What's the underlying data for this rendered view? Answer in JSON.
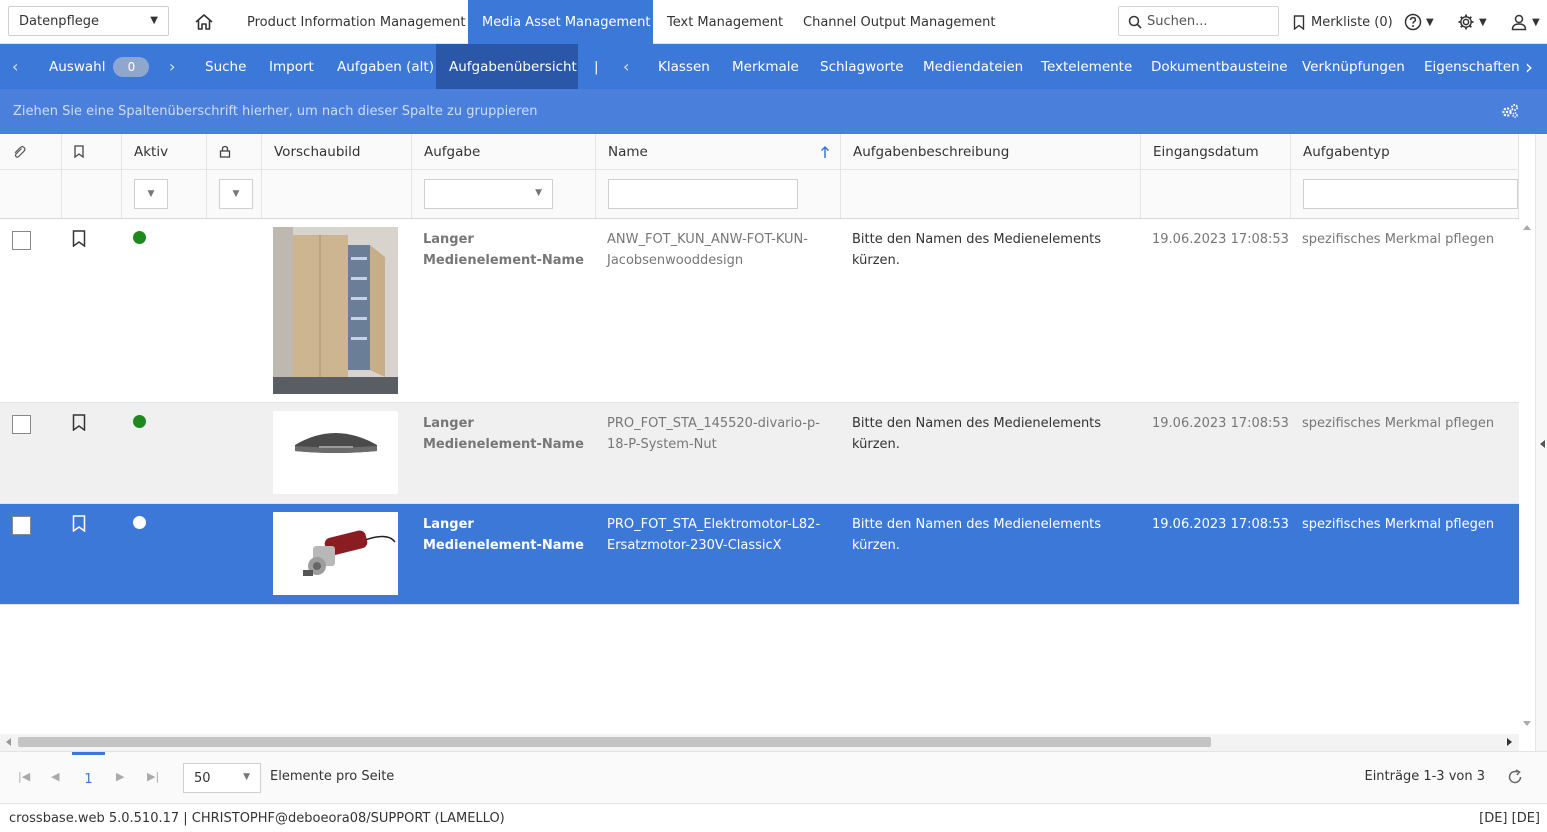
{
  "topbar": {
    "module_select": "Datenpflege",
    "tabs": [
      {
        "label": "Product Information Management",
        "active": false
      },
      {
        "label": "Media Asset Management",
        "active": true
      },
      {
        "label": "Text Management",
        "active": false
      },
      {
        "label": "Channel Output Management",
        "active": false
      }
    ],
    "search_placeholder": "Suchen...",
    "merkliste": "Merkliste (0)"
  },
  "subnav": {
    "auswahl_label": "Auswahl",
    "auswahl_count": "0",
    "items": [
      "Suche",
      "Import",
      "Aufgaben (alt)",
      "Aufgabenübersicht"
    ],
    "separator": "|",
    "items2": [
      "Klassen",
      "Merkmale",
      "Schlagworte",
      "Mediendateien",
      "Textelemente",
      "Dokumentbausteine",
      "Verknüpfungen",
      "Eigenschaften"
    ]
  },
  "groupbar": {
    "hint": "Ziehen Sie eine Spaltenüberschrift hierher, um nach dieser Spalte zu gruppieren"
  },
  "columns": {
    "aktiv": "Aktiv",
    "vorschaubild": "Vorschaubild",
    "aufgabe": "Aufgabe",
    "name": "Name",
    "beschreibung": "Aufgabenbeschreibung",
    "eingangsdatum": "Eingangsdatum",
    "aufgabentyp": "Aufgabentyp"
  },
  "rows": [
    {
      "aufgabe": "Langer Medienelement-Name",
      "name": "ANW_FOT_KUN_ANW-FOT-KUN-Jacobsenwooddesign",
      "beschreibung": "Bitte den Namen des Medienelements kürzen.",
      "datum": "19.06.2023 17:08:53",
      "typ": "spezifisches Merkmal pflegen",
      "aktiv_color": "#1e8a1e"
    },
    {
      "aufgabe": "Langer Medienelement-Name",
      "name": "PRO_FOT_STA_145520-divario-p-18-P-System-Nut",
      "beschreibung": "Bitte den Namen des Medienelements kürzen.",
      "datum": "19.06.2023 17:08:53",
      "typ": "spezifisches Merkmal pflegen",
      "aktiv_color": "#1e8a1e"
    },
    {
      "aufgabe": "Langer Medienelement-Name",
      "name": "PRO_FOT_STA_Elektromotor-L82-Ersatzmotor-230V-ClassicX",
      "beschreibung": "Bitte den Namen des Medienelements kürzen.",
      "datum": "19.06.2023 17:08:53",
      "typ": "spezifisches Merkmal pflegen",
      "aktiv_color": "#ffffff"
    }
  ],
  "pager": {
    "page": "1",
    "page_size": "50",
    "per_page_label": "Elemente pro Seite",
    "count": "Einträge 1-3 von 3"
  },
  "footer": {
    "version": "crossbase.web 5.0.510.17 | CHRISTOPHF@deboeora08/SUPPORT (LAMELLO)",
    "lang": "[DE] [DE]"
  },
  "colors": {
    "accent": "#3c78d8",
    "accent_dark": "#2b57a8",
    "selected_row": "#3c78d8"
  }
}
